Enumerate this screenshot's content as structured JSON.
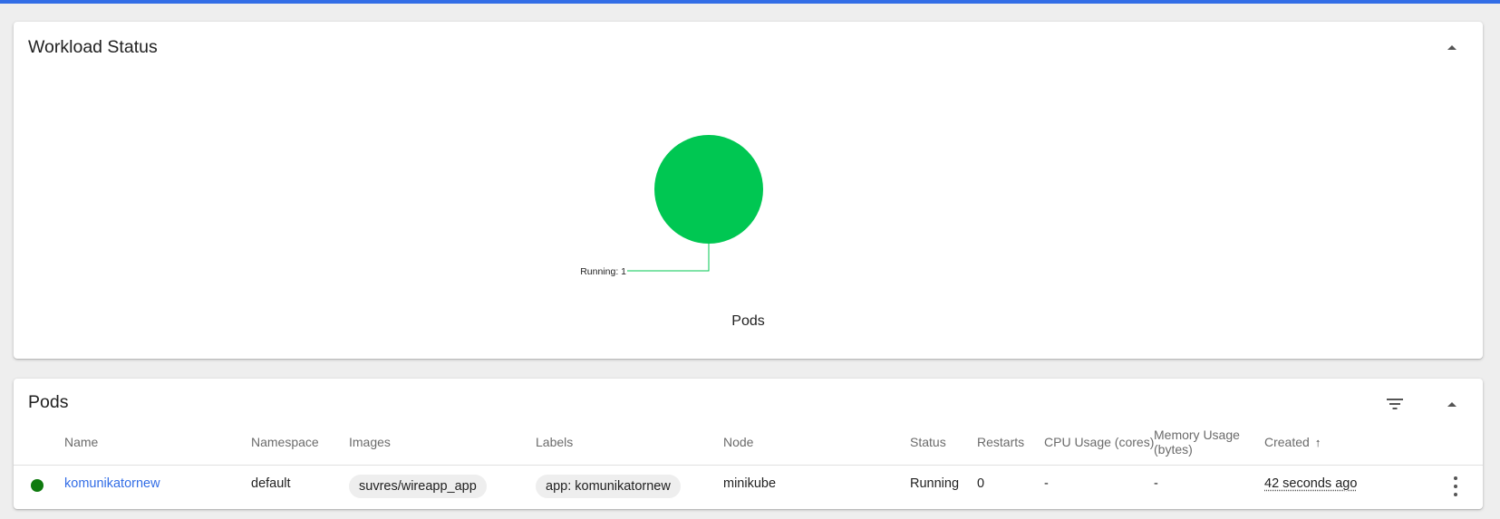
{
  "colors": {
    "accent_bar": "#326de6",
    "running": "#00c752",
    "status_dot_running": "#0e7a0e",
    "link": "#326de6"
  },
  "workload_status": {
    "title": "Workload Status",
    "collapse_icon": "arrow-drop-up-icon"
  },
  "chart_data": {
    "type": "pie",
    "title": "Pods",
    "slices": [
      {
        "label": "Running",
        "value": 1,
        "color": "#00c752"
      }
    ],
    "slice_label_text": "Running: 1"
  },
  "pods": {
    "title": "Pods",
    "filter_icon": "filter-list-icon",
    "collapse_icon": "arrow-drop-up-icon",
    "columns": {
      "name": "Name",
      "namespace": "Namespace",
      "images": "Images",
      "labels": "Labels",
      "node": "Node",
      "status": "Status",
      "restarts": "Restarts",
      "cpu": "CPU Usage (cores)",
      "memory_line1": "Memory Usage",
      "memory_line2": "(bytes)",
      "created": "Created",
      "created_sort": "↑"
    },
    "rows": [
      {
        "status_icon": "running-status-icon",
        "name": "komunikatornew",
        "namespace": "default",
        "image": "suvres/wireapp_app",
        "label": "app: komunikatornew",
        "node": "minikube",
        "status": "Running",
        "restarts": "0",
        "cpu": "-",
        "memory": "-",
        "created": "42 seconds ago",
        "menu_icon": "more-vert-icon"
      }
    ]
  }
}
